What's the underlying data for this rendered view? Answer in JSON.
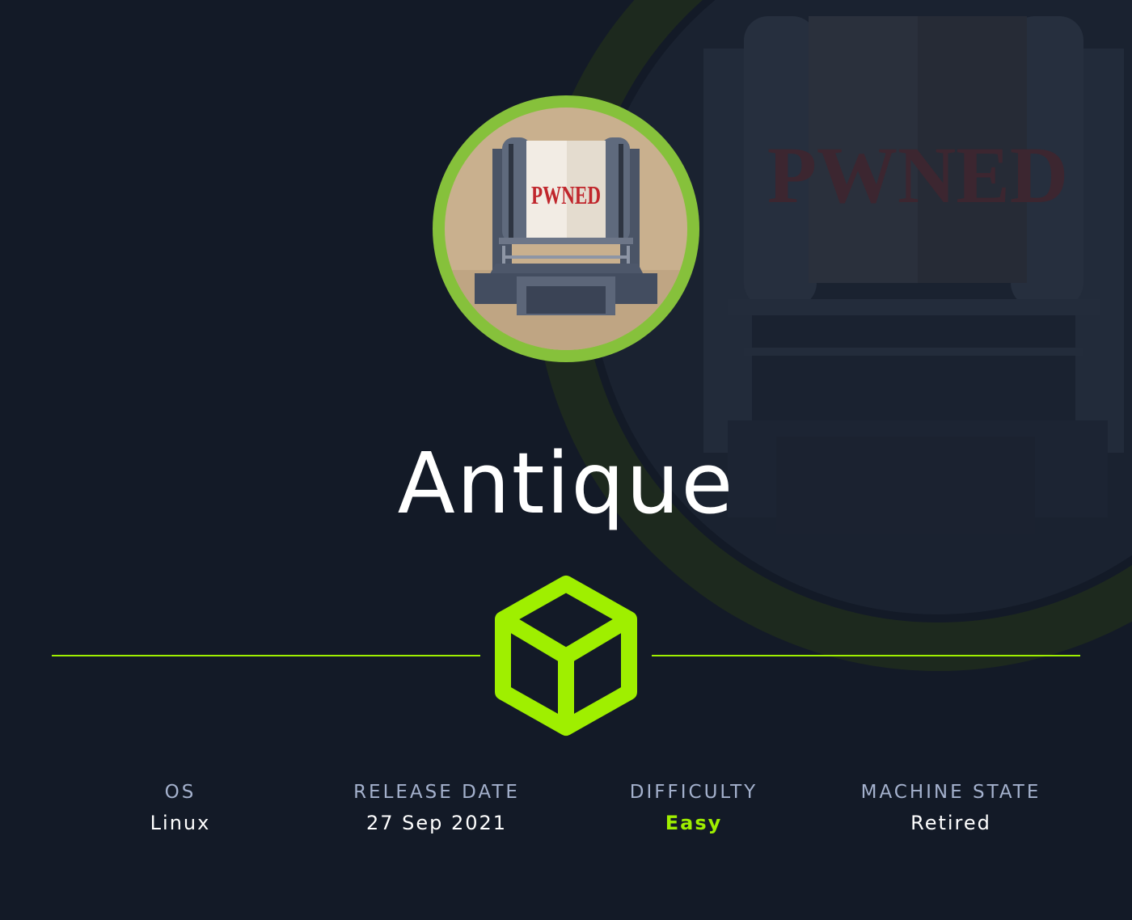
{
  "machine": {
    "name": "Antique",
    "avatar_text": "PWNED"
  },
  "stats": [
    {
      "label": "OS",
      "value": "Linux"
    },
    {
      "label": "RELEASE DATE",
      "value": "27 Sep 2021"
    },
    {
      "label": "DIFFICULTY",
      "value": "Easy"
    },
    {
      "label": "MACHINE STATE",
      "value": "Retired"
    }
  ],
  "icons": {
    "avatar": "printer-pwned-avatar",
    "divider": "cube-icon"
  },
  "colors": {
    "background": "#131a27",
    "accent": "#9fef00",
    "avatar_ring": "#86c13b",
    "label": "#a4b1cd",
    "stamp_red": "#c0262c"
  }
}
